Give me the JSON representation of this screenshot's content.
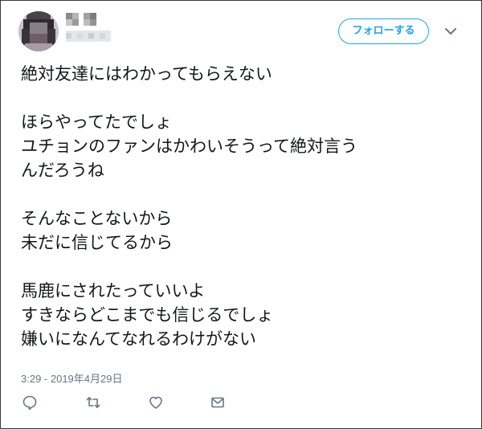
{
  "tweet": {
    "follow_label": "フォローする",
    "text_paragraphs": [
      [
        "絶対友達にはわかってもらえない"
      ],
      [
        "ほらやってたでしょ",
        "ユチョンのファンはかわいそうって絶対言う",
        "んだろうね"
      ],
      [
        "そんなことないから",
        "未だに信じてるから"
      ],
      [
        "馬鹿にされたっていいよ",
        "すきならどこまでも信じるでしょ",
        "嫌いになんてなれるわけがない"
      ]
    ],
    "timestamp": "3:29 - 2019年4月29日"
  },
  "icons": {
    "more": "chevron-down-icon",
    "reply": "reply-icon",
    "retweet": "retweet-icon",
    "like": "heart-icon",
    "message": "envelope-icon"
  },
  "colors": {
    "accent": "#1da1f2",
    "text": "#14171a",
    "muted": "#657786",
    "border": "#3a3a3a"
  }
}
